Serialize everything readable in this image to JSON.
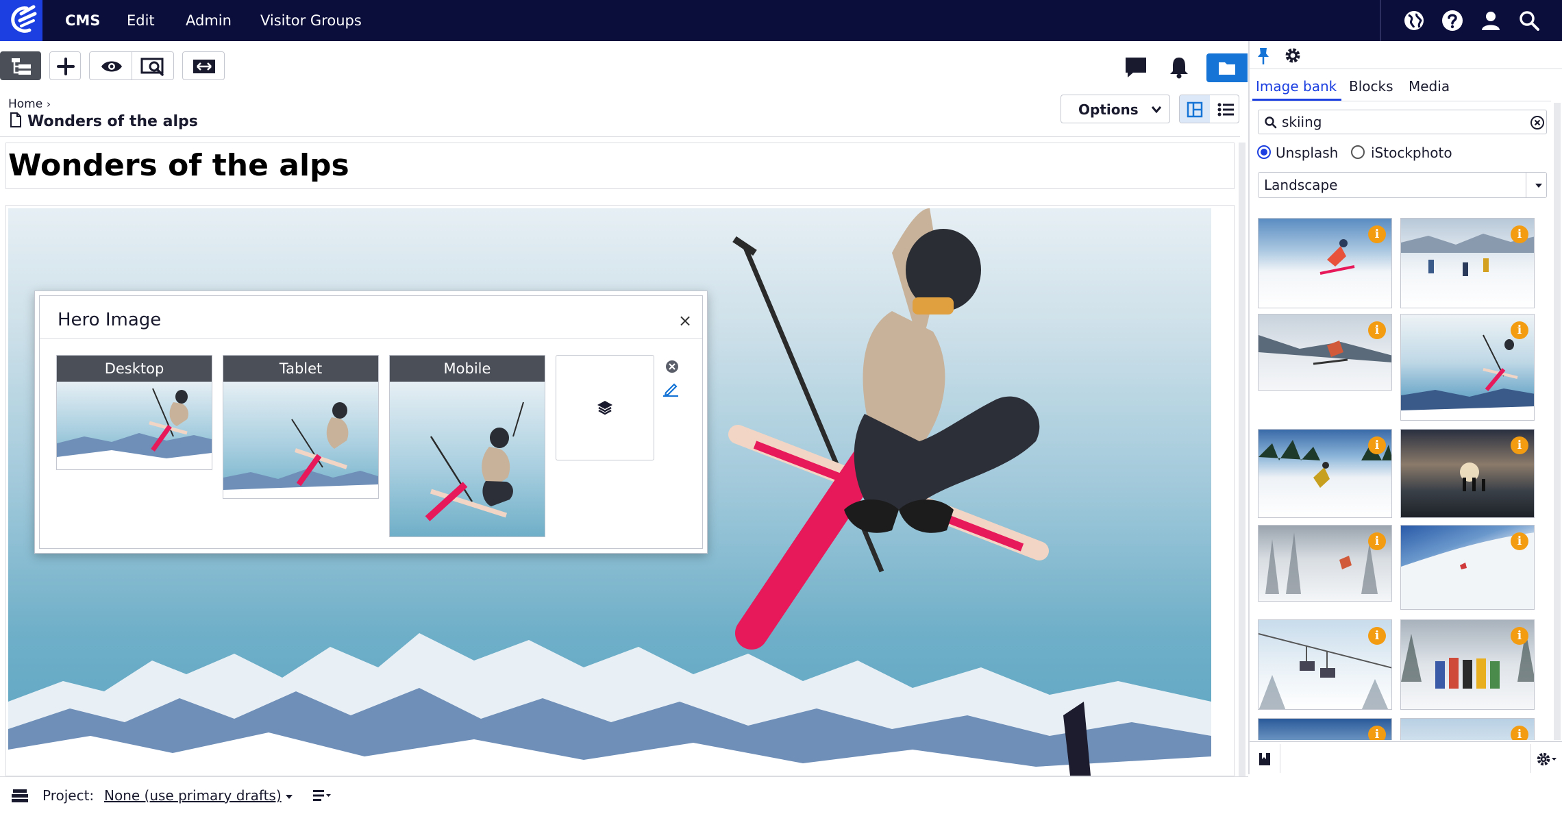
{
  "topnav": {
    "items": [
      "CMS",
      "Edit",
      "Admin",
      "Visitor Groups"
    ],
    "icons": [
      "globe-icon",
      "help-icon",
      "user-icon",
      "search-icon"
    ]
  },
  "toolbar": {
    "icons": [
      "page-tree-icon",
      "add-icon",
      "preview-eye-icon",
      "preview-search-icon",
      "compare-icon",
      "comments-icon",
      "notifications-bell-icon",
      "assets-folder-icon"
    ]
  },
  "breadcrumb": {
    "home": "Home",
    "current": "Wonders of the alps"
  },
  "options": {
    "label": "Options"
  },
  "page": {
    "title": "Wonders of the alps"
  },
  "dialog": {
    "title": "Hero Image",
    "close": "×",
    "variants": [
      "Desktop",
      "Tablet",
      "Mobile"
    ]
  },
  "right_panel": {
    "tabs": [
      "Image bank",
      "Blocks",
      "Media"
    ],
    "active_tab": "Image bank",
    "search_value": "skiing",
    "sources": [
      "Unsplash",
      "iStockphoto"
    ],
    "selected_source": "Unsplash",
    "orientation": "Landscape",
    "info_badge": "i",
    "accent_color": "#1b3fe0",
    "badge_color": "#f39c12"
  },
  "bottom": {
    "project_label": "Project:",
    "project_value": "None (use primary drafts)"
  },
  "colors": {
    "nav_bg": "#0b0d3b",
    "logo_bg": "#1b3fe0",
    "folder_btn": "#1574d6"
  }
}
